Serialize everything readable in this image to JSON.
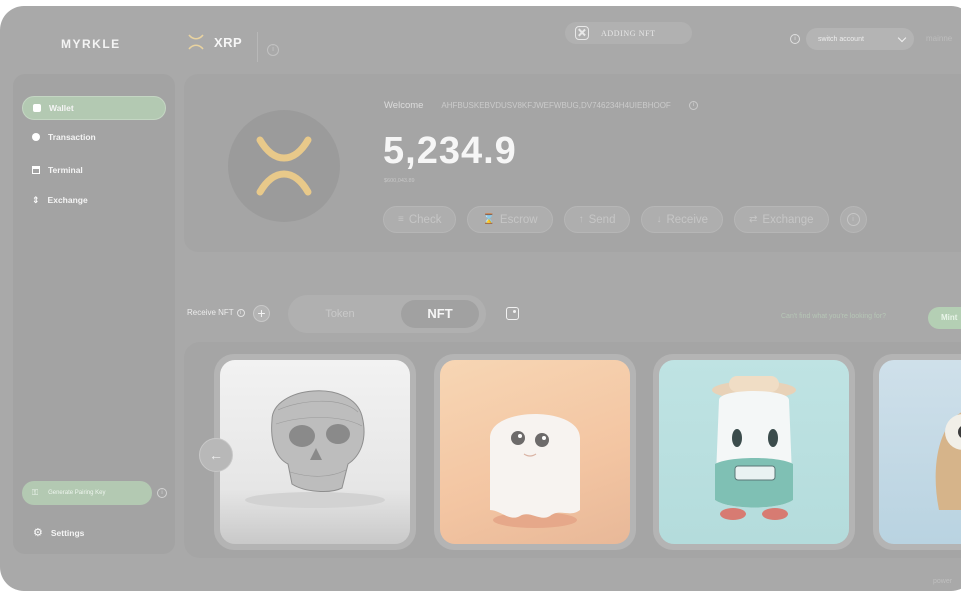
{
  "header": {
    "logo": "MYRKLE",
    "coin_name": "XRP",
    "coin_info_icon": "info-icon",
    "adding_nft_label": "ADDING NFT",
    "account_select_value": "switch account",
    "right_text": "mainne"
  },
  "sidebar": {
    "items": [
      {
        "label": "Wallet",
        "icon": "wallet-icon",
        "active": true
      },
      {
        "label": "Transaction",
        "icon": "transaction-icon",
        "active": false
      },
      {
        "label": "Terminal",
        "icon": "terminal-icon",
        "active": false
      },
      {
        "label": "Exchange",
        "icon": "exchange-icon",
        "active": false
      }
    ],
    "generate_button": "Generate Pairing Key",
    "settings_label": "Settings"
  },
  "wallet": {
    "welcome_label": "Welcome",
    "address": "AHFBUSKEBVDUSV8KFJWEFWBUG,DV746234H4UIEBHOOF",
    "balance": "5,234.9",
    "fiat_value": "$600,043.89",
    "actions": [
      {
        "label": "Check",
        "icon": "check-icon"
      },
      {
        "label": "Escrow",
        "icon": "escrow-icon"
      },
      {
        "label": "Send",
        "icon": "send-icon"
      },
      {
        "label": "Receive",
        "icon": "receive-icon"
      },
      {
        "label": "Exchange",
        "icon": "exchange-icon"
      }
    ]
  },
  "nft_section": {
    "receive_label": "Receive NFT",
    "tabs": [
      {
        "label": "Token",
        "active": false
      },
      {
        "label": "NFT",
        "active": true
      }
    ],
    "cant_find_text": "Can't find what you're looking for?",
    "mint_label": "Mint"
  },
  "gallery": {
    "cards": [
      {
        "subject": "skull sculpture"
      },
      {
        "subject": "ghost figure"
      },
      {
        "subject": "hat character"
      },
      {
        "subject": "owl character"
      }
    ]
  },
  "footer": {
    "powered_text": "power"
  },
  "colors": {
    "background": "#a9a9a9",
    "accent_green": "#b3c9b2",
    "xrp_gold": "#e8c98a"
  }
}
